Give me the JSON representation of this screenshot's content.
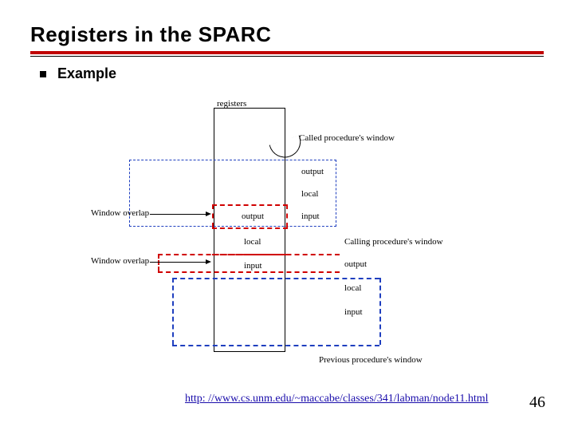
{
  "title": "Registers in the SPARC",
  "bullet": "Example",
  "diagram": {
    "registers_label": "registers",
    "called_window_label": "Called procedure's window",
    "calling_window_label": "Calling procedure's window",
    "previous_window_label": "Previous procedure's window",
    "window_overlap_label": "Window overlap",
    "sections": {
      "output": "output",
      "local": "local",
      "input": "input"
    },
    "called": {
      "output": "output",
      "local": "local",
      "input": "input"
    },
    "calling": {
      "output": "output",
      "local": "local",
      "input": "input"
    },
    "previous": {
      "output": "output",
      "local": "local",
      "input": "input"
    }
  },
  "link": {
    "text": "http: //www.cs.unm.edu/~maccabe/classes/341/labman/node11.html"
  },
  "page_number": "46"
}
